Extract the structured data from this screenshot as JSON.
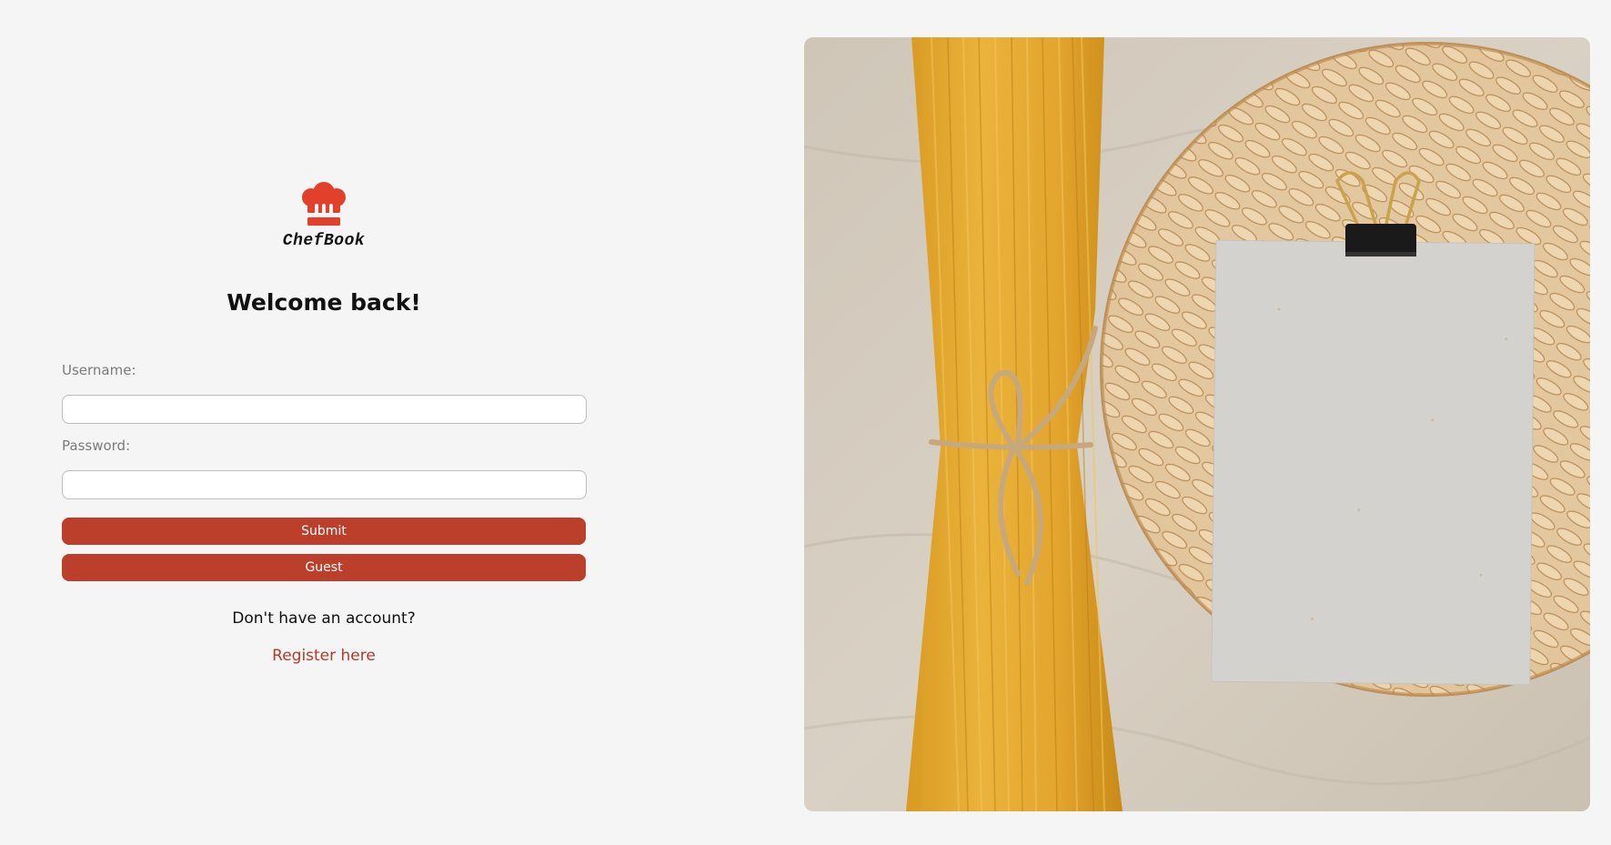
{
  "brand": {
    "name": "ChefBook",
    "logo_icon": "chef-hat-icon",
    "accent_color": "#bc3f2c",
    "logo_color": "#e2402a"
  },
  "login": {
    "heading": "Welcome back!",
    "username_label": "Username:",
    "username_value": "",
    "password_label": "Password:",
    "password_value": "",
    "submit_label": "Submit",
    "guest_label": "Guest",
    "no_account_text": "Don't have an account?",
    "register_link": "Register here"
  }
}
